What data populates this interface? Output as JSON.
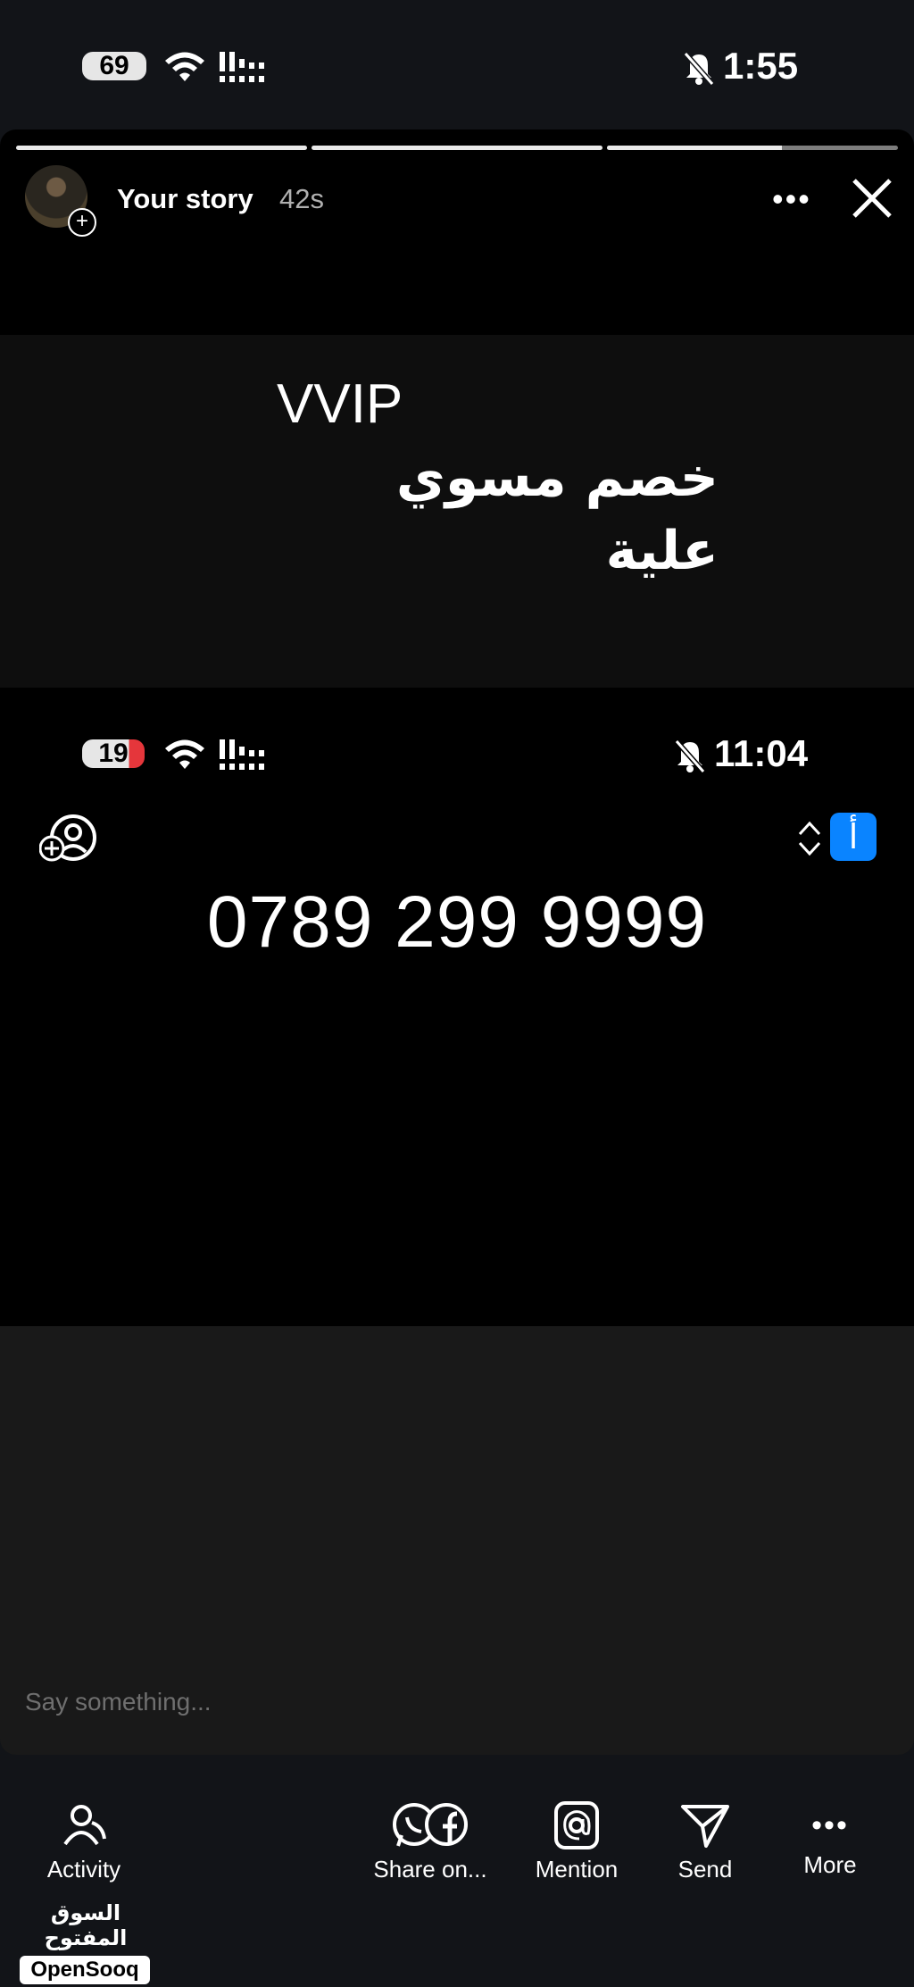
{
  "status_bar": {
    "battery": "69",
    "time": "1:55"
  },
  "story": {
    "progress": [
      1.0,
      1.0,
      0.6
    ],
    "user_label": "Your story",
    "elapsed": "42s",
    "caption_line1": "VVIP",
    "caption_line2": "خصم مسوي علية",
    "inner_status": {
      "battery": "19",
      "time": "11:04"
    },
    "phone_number": "0789 299 9999",
    "language_badge": "أ",
    "input_placeholder": "Say something..."
  },
  "actions": [
    {
      "label": "Activity"
    },
    {
      "label": "Share on..."
    },
    {
      "label": "Mention"
    },
    {
      "label": "Send"
    },
    {
      "label": "More"
    }
  ],
  "watermark": {
    "arabic": "السوق المفتوح",
    "english": "OpenSooq"
  },
  "colors": {
    "background": "#121418",
    "accent_blue": "#0a84ff",
    "battery_red": "#e5363b"
  }
}
